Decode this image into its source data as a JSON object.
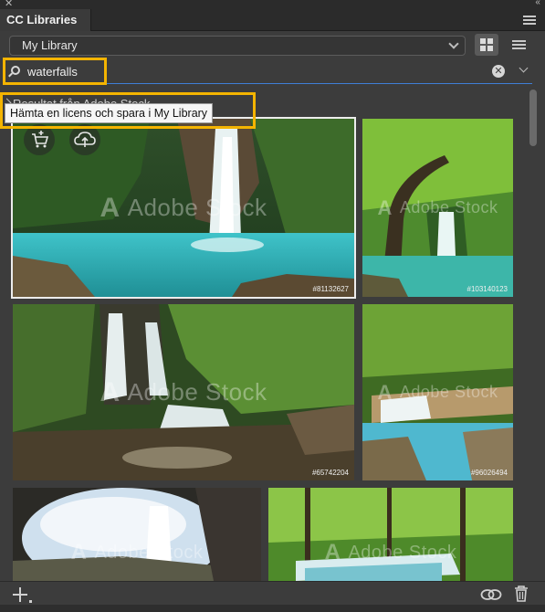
{
  "app": {
    "tab_title": "CC Libraries",
    "close_glyph": "✕",
    "collapse_glyph": "‹‹"
  },
  "library_select": {
    "value": "My Library"
  },
  "search": {
    "query": "waterfalls",
    "clear_glyph": "✕"
  },
  "results": {
    "section_label": "Resultat från Adobe Stock",
    "tooltip": "Hämta en licens och spara i My Library"
  },
  "watermark": {
    "brand": "Adobe Stock",
    "mark": "A"
  },
  "thumbnails": [
    {
      "stock_id": "#81132627",
      "selected": true
    },
    {
      "stock_id": "#103140123",
      "selected": false
    },
    {
      "stock_id": "#65742204",
      "selected": false
    },
    {
      "stock_id": "#96026494",
      "selected": false
    },
    {
      "stock_id": "",
      "selected": false
    },
    {
      "stock_id": "",
      "selected": false
    }
  ],
  "colors": {
    "accent_blue": "#3f7fd6",
    "highlight_yellow": "#f4b400",
    "panel_bg": "#3c3c3c"
  },
  "icons": {
    "license_cart": "cart-plus-icon",
    "save_cloud": "cloud-upload-icon",
    "grid_view": "grid-view-icon",
    "list_view": "list-view-icon",
    "add": "plus-icon",
    "link": "link-icon",
    "delete": "trash-icon"
  }
}
